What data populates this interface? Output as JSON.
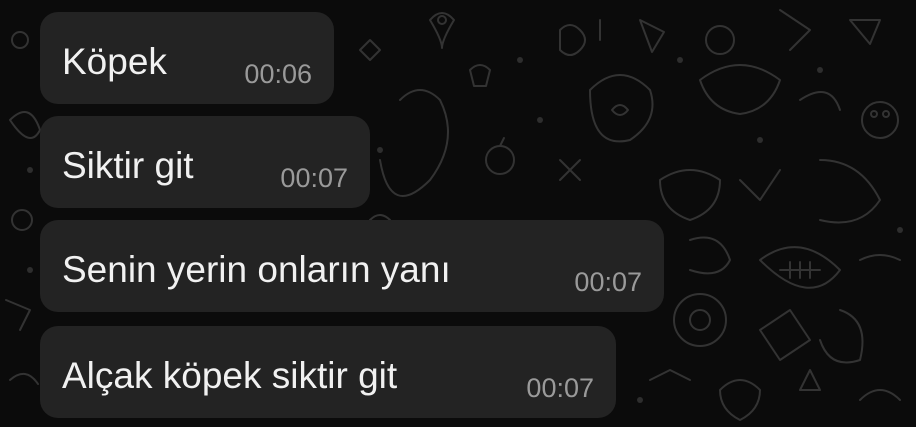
{
  "chat": {
    "messages": [
      {
        "text": "Köpek",
        "time": "00:06"
      },
      {
        "text": "Siktir git",
        "time": "00:07"
      },
      {
        "text": "Senin yerin onların yanı",
        "time": "00:07"
      },
      {
        "text": "Alçak köpek siktir git",
        "time": "00:07"
      }
    ]
  },
  "colors": {
    "background": "#0b0b0b",
    "bubble": "#232323",
    "text": "#f1f1f1",
    "timestamp": "#9a9a9a",
    "doodle": "#3a3a3a"
  }
}
